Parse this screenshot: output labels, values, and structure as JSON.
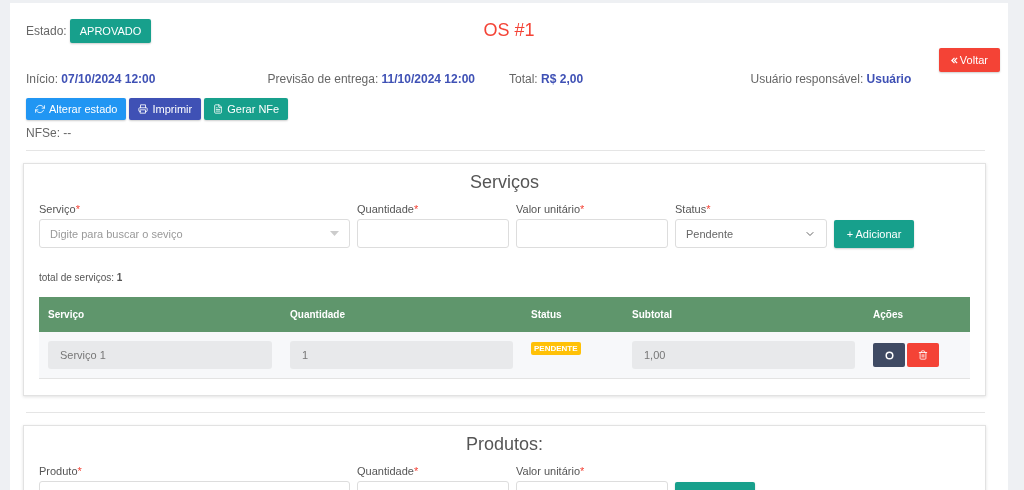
{
  "header": {
    "state_label": "Estado:",
    "state": "APROVADO",
    "title": "OS #1",
    "back_button": "Voltar"
  },
  "info": [
    {
      "label": "Início:",
      "value": "07/10/2024 12:00"
    },
    {
      "label": "Previsão de entrega:",
      "value": "11/10/2024 12:00"
    },
    {
      "label": "Total:",
      "value": "R$ 2,00"
    },
    {
      "label": "Usuário responsável:",
      "value": "Usuário"
    }
  ],
  "actions": [
    {
      "kind": "refresh",
      "label": "Alterar estado"
    },
    {
      "kind": "print",
      "label": "Imprimir"
    },
    {
      "kind": "file",
      "label": "Gerar NFe"
    }
  ],
  "nfse": "NFSe: --",
  "services": {
    "title": "Serviços",
    "fields": [
      {
        "kind": "search",
        "label": "Serviço",
        "mark": "*",
        "placeholder": "Digite para buscar o seviço"
      },
      {
        "kind": "text",
        "label": "Quantidade",
        "mark": "*"
      },
      {
        "kind": "text",
        "label": "Valor unitário",
        "mark": "*"
      },
      {
        "kind": "select",
        "label": "Status",
        "mark": "*",
        "value": "Pendente"
      }
    ],
    "add_button": "+ Adicionar",
    "total_label": "total de serviços:",
    "total": "1",
    "columns": [
      "Serviço",
      "Quantidade",
      "Status",
      "Subtotal",
      "Ações"
    ],
    "rows": [
      {
        "service": "Serviço 1",
        "quantity": "1",
        "status": "PENDENTE",
        "subtotal": "1,00"
      }
    ]
  },
  "products": {
    "title": "Produtos:",
    "fields": [
      {
        "label": "Produto",
        "mark": "*"
      },
      {
        "label": "Quantidade",
        "mark": "*"
      },
      {
        "label": "Valor unitário",
        "mark": "*"
      }
    ]
  }
}
